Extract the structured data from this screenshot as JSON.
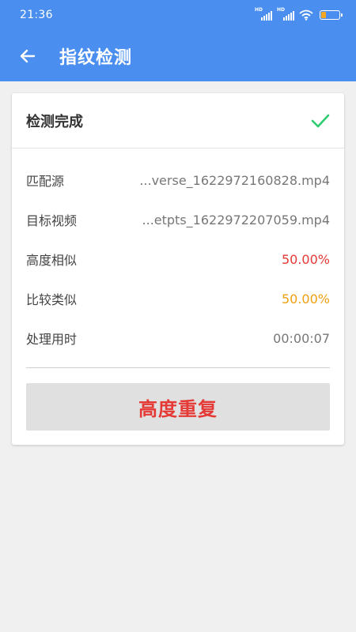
{
  "status_bar": {
    "time": "21:36",
    "signal_1_badge": "HD",
    "signal_2_badge": "HD",
    "battery_level": 0.25,
    "battery_color": "#f5a623"
  },
  "toolbar": {
    "title": "指纹检测",
    "back_icon": "arrow-left-icon",
    "background": "#4a8ff0"
  },
  "card": {
    "header_title": "检测完成",
    "header_icon": "checkmark-icon",
    "check_color": "#2ecc71",
    "rows": [
      {
        "label": "匹配源",
        "value": "...verse_1622972160828.mp4"
      },
      {
        "label": "目标视频",
        "value": "...etpts_1622972207059.mp4"
      },
      {
        "label": "高度相似",
        "value": "50.00%"
      },
      {
        "label": "比较类似",
        "value": "50.00%"
      },
      {
        "label": "处理用时",
        "value": "00:00:07"
      }
    ],
    "result_label": "高度重复"
  }
}
